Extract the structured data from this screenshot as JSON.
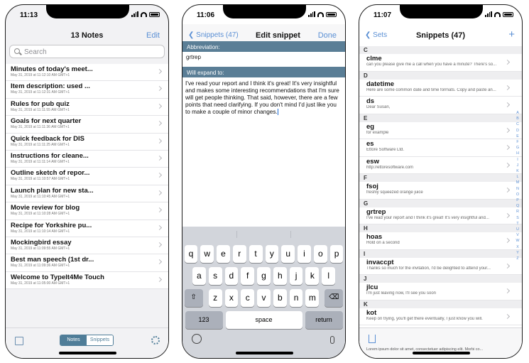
{
  "screens": {
    "notes": {
      "time": "11:13",
      "title": "13 Notes",
      "edit_label": "Edit",
      "search_placeholder": "Search",
      "notes": [
        {
          "title": "Minutes of today's meet...",
          "date": "May 31, 2019 at 11:12:10 AM GMT+1"
        },
        {
          "title": "Item description: used ...",
          "date": "May 31, 2019 at 11:12:31 AM GMT+1"
        },
        {
          "title": "Rules for pub quiz",
          "date": "May 31, 2019 at 11:11:55 AM GMT+1"
        },
        {
          "title": "Goals for next quarter",
          "date": "May 31, 2019 at 11:11:36 AM GMT+1"
        },
        {
          "title": "Quick feedback for DIS",
          "date": "May 31, 2019 at 11:11:25 AM GMT+1"
        },
        {
          "title": "Instructions for cleane...",
          "date": "May 31, 2019 at 11:11:14 AM GMT+1"
        },
        {
          "title": "Outline sketch of repor...",
          "date": "May 31, 2019 at 11:10:57 AM GMT+1"
        },
        {
          "title": "Launch plan for new sta...",
          "date": "May 31, 2019 at 11:10:45 AM GMT+1"
        },
        {
          "title": "Movie review for blog",
          "date": "May 31, 2019 at 11:10:28 AM GMT+1"
        },
        {
          "title": "Recipe for Yorkshire pu...",
          "date": "May 31, 2019 at 11:10:14 AM GMT+1"
        },
        {
          "title": "Mockingbird essay",
          "date": "May 31, 2019 at 11:09:55 AM GMT+1"
        },
        {
          "title": "Best man speech (1st dr...",
          "date": "May 31, 2019 at 11:09:36 AM GMT+1"
        },
        {
          "title": "Welcome to TypeIt4Me Touch",
          "date": "May 31, 2019 at 11:05:00 AM GMT+1"
        }
      ],
      "segment": {
        "notes": "Notes",
        "snippets": "Snippets"
      }
    },
    "edit": {
      "time": "11:06",
      "back_label": "Snippets (47)",
      "title": "Edit snippet",
      "done_label": "Done",
      "abbreviation_header": "Abbreviation:",
      "abbreviation_value": "grtrep",
      "expand_header": "Will expand to:",
      "expansion": "I've read your report and I think it's great! It's very insightful and makes some interesting recommendations that I'm sure will get people thinking. That said, however, there are a few points that need clarifying. If you don't mind I'd just like you to make a couple of minor changes.",
      "keyboard": {
        "row1": [
          "q",
          "w",
          "e",
          "r",
          "t",
          "y",
          "u",
          "i",
          "o",
          "p"
        ],
        "row2": [
          "a",
          "s",
          "d",
          "f",
          "g",
          "h",
          "j",
          "k",
          "l"
        ],
        "row3": [
          "z",
          "x",
          "c",
          "v",
          "b",
          "n",
          "m"
        ],
        "numbers": "123",
        "space": "space",
        "return": "return"
      }
    },
    "snippets": {
      "time": "11:07",
      "back_label": "Sets",
      "title": "Snippets (47)",
      "add_label": "+",
      "sections": [
        {
          "letter": "C",
          "items": [
            {
              "abbr": "clme",
              "exp": "can you please give me a call when you have a minute? There's so..."
            }
          ]
        },
        {
          "letter": "D",
          "items": [
            {
              "abbr": "datetime",
              "exp": "Here are some common date and time formats. Copy and paste an..."
            },
            {
              "abbr": "ds",
              "exp": "Dear Susan,"
            }
          ]
        },
        {
          "letter": "E",
          "items": [
            {
              "abbr": "eg",
              "exp": "for example"
            },
            {
              "abbr": "es",
              "exp": "Ettore Software Ltd."
            },
            {
              "abbr": "esw",
              "exp": "http://ettoresoftware.com"
            }
          ]
        },
        {
          "letter": "F",
          "items": [
            {
              "abbr": "fsoj",
              "exp": "freshly squeezed orange juice"
            }
          ]
        },
        {
          "letter": "G",
          "items": [
            {
              "abbr": "grtrep",
              "exp": "I've read your report and I think it's great! It's very insightful and..."
            }
          ]
        },
        {
          "letter": "H",
          "items": [
            {
              "abbr": "hoas",
              "exp": "Hold on a second"
            }
          ]
        },
        {
          "letter": "I",
          "items": [
            {
              "abbr": "invaccpt",
              "exp": "Thanks so much for the invitation, I'd be delighted to attend your..."
            }
          ]
        },
        {
          "letter": "J",
          "items": [
            {
              "abbr": "jlcu",
              "exp": "I'm just leaving now, I'll see you soon"
            }
          ]
        },
        {
          "letter": "K",
          "items": [
            {
              "abbr": "kot",
              "exp": "Keep on trying, you'll get there eventually, I just know you will."
            }
          ]
        }
      ],
      "last_partial": "Lorem ipsum dolor sit amet, consectetuer adipiscing elit. Morbi co...",
      "index": [
        "A",
        "B",
        "C",
        "D",
        "E",
        "F",
        "G",
        "H",
        "I",
        "J",
        "K",
        "L",
        "M",
        "N",
        "O",
        "P",
        "Q",
        "R",
        "S",
        "T",
        "U",
        "V",
        "W",
        "X",
        "Y",
        "Z"
      ]
    }
  }
}
